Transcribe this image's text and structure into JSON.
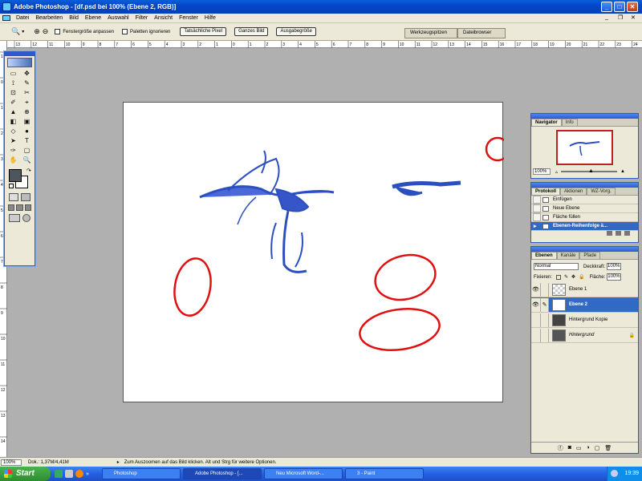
{
  "window": {
    "title": "Adobe Photoshop - [df.psd bei 100% (Ebene 2, RGB)]",
    "title_icon": "photoshop-icon",
    "controls": {
      "minimize": "_",
      "maximize": "□",
      "close": "✕"
    },
    "doc_controls": {
      "minimize": "_",
      "restore": "❐",
      "close": "✕"
    }
  },
  "menu": [
    "Datei",
    "Bearbeiten",
    "Bild",
    "Ebene",
    "Auswahl",
    "Filter",
    "Ansicht",
    "Fenster",
    "Hilfe"
  ],
  "options": {
    "tool_icon": "zoom-icon",
    "tool_glyph": "🔍",
    "zoom_in": "⊕",
    "zoom_out": "⊖",
    "checkbox_fit": "Fenstergröße anpassen",
    "checkbox_ignore": "Paletten ignorieren",
    "btn_actual": "Tatsächliche Pixel",
    "btn_fit": "Ganzes Bild",
    "btn_print": "Ausgabegröße",
    "well_tabs": [
      "Werkzeugspitzen",
      "Dateibrowser"
    ]
  },
  "rulers": {
    "top_labels": [
      "13",
      "12",
      "11",
      "10",
      "9",
      "8",
      "7",
      "6",
      "5",
      "4",
      "3",
      "2",
      "1",
      "0",
      "1",
      "2",
      "3",
      "4",
      "5",
      "6",
      "7",
      "8",
      "9",
      "10",
      "11",
      "12",
      "13",
      "14",
      "15",
      "16",
      "17",
      "18",
      "19",
      "20",
      "21",
      "22",
      "23",
      "24"
    ],
    "left_labels": [
      "1",
      "0",
      "1",
      "2",
      "3",
      "4",
      "5",
      "6",
      "7",
      "8",
      "9",
      "10",
      "11",
      "12",
      "13",
      "14"
    ]
  },
  "toolbox": {
    "tools": [
      "▭",
      "✥",
      "⟟",
      "✎",
      "⊡",
      "✂",
      "✐",
      "⌖",
      "▲",
      "⊕",
      "◧",
      "▣",
      "◇",
      "●",
      "➤",
      "T",
      "✑",
      "▢",
      "✋",
      "🔍"
    ]
  },
  "navigator": {
    "tabs": [
      "Navigator",
      "Info"
    ],
    "zoom": "100%"
  },
  "history": {
    "tabs": [
      "Protokoll",
      "Aktionen",
      "WZ-Vorg."
    ],
    "items": [
      "Einfügen",
      "Neue Ebene",
      "Fläche füllen",
      "Ebenen-Reihenfolge ä..."
    ],
    "active_index": 3
  },
  "layers": {
    "tabs": [
      "Ebenen",
      "Kanäle",
      "Pfade"
    ],
    "blend_mode": "Normal",
    "opacity_label": "Deckkraft:",
    "opacity": "100%",
    "lock_label": "Fixieren:",
    "fill_label": "Fläche:",
    "fill": "100%",
    "rows": [
      {
        "name": "Ebene 1",
        "visible": true,
        "selected": false
      },
      {
        "name": "Ebene 2",
        "visible": true,
        "selected": true
      },
      {
        "name": "Hintergrund Kopie",
        "visible": false,
        "selected": false
      },
      {
        "name": "Hintergrund",
        "visible": false,
        "selected": false
      }
    ]
  },
  "status": {
    "zoom": "100%",
    "doc": "Dok.: 1,37M/4,41M",
    "hint": "Zum Auszoomen auf das Bild klicken. Alt und Strg für weitere Optionen."
  },
  "taskbar": {
    "start": "Start",
    "tasks": [
      "Photoshop",
      "Adobe Photoshop - [...",
      "Neu Microsoft Word-...",
      "3 - Paint"
    ],
    "clock": "19:39"
  },
  "colors": {
    "accent": "#316ac5",
    "xp_blue": "#245edc",
    "annotation_red": "#e01010",
    "sketch_blue": "#2c4fc0"
  }
}
